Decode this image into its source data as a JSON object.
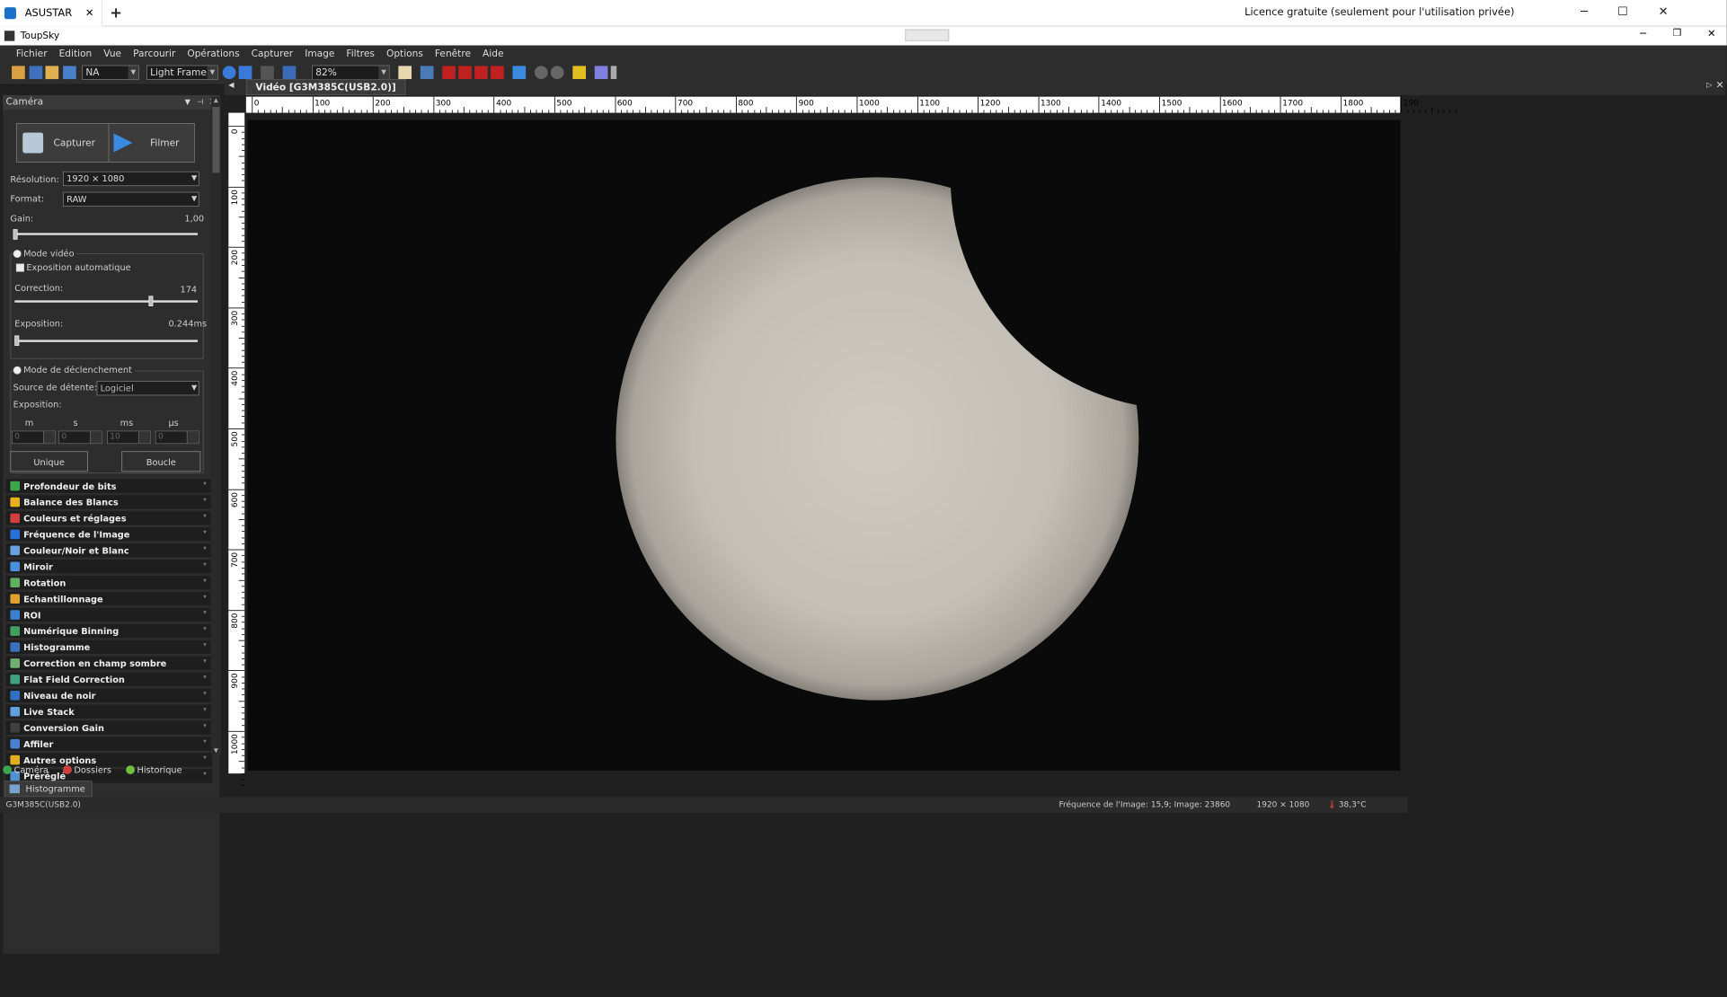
{
  "browser": {
    "tab_label": "ASUSTAR",
    "licence": "Licence gratuite (seulement pour l'utilisation privée)"
  },
  "app": {
    "title": "ToupSky"
  },
  "menu": [
    "Fichier",
    "Edition",
    "Vue",
    "Parcourir",
    "Opérations",
    "Capturer",
    "Image",
    "Filtres",
    "Options",
    "Fenêtre",
    "Aide"
  ],
  "toolbar": {
    "combo1": "NA",
    "combo2": "Light Frame",
    "zoom": "82%"
  },
  "camera_panel": {
    "title": "Caméra",
    "capture_label": "Capturer",
    "film_label": "Filmer",
    "resolution_label": "Résolution:",
    "resolution_value": "1920 × 1080",
    "format_label": "Format:",
    "format_value": "RAW",
    "gain_label": "Gain:",
    "gain_value": "1,00",
    "gain_level": 0.0,
    "video_mode_label": "Mode vidéo",
    "auto_exposure_label": "Exposition automatique",
    "correction_label": "Correction:",
    "correction_value": "174",
    "correction_level": 0.75,
    "exposure_label": "Exposition:",
    "exposure_value": "0.244ms",
    "exposure_level": 0.0,
    "trigger_mode_label": "Mode de déclenchement",
    "trigger_source_label": "Source de détente:",
    "trigger_source_value": "Logiciel",
    "trigger_exposure_label": "Exposition:",
    "units": [
      "m",
      "s",
      "ms",
      "µs"
    ],
    "unit_values": [
      "0",
      "0",
      "10",
      "0"
    ],
    "single_label": "Unique",
    "loop_label": "Boucle"
  },
  "accordion": [
    {
      "label": "Profondeur de bits",
      "color": "#3aa84a"
    },
    {
      "label": "Balance des Blancs",
      "color": "#e8b020"
    },
    {
      "label": "Couleurs et réglages",
      "color": "#d04040"
    },
    {
      "label": "Fréquence de l'Image",
      "color": "#2a70d8"
    },
    {
      "label": "Couleur/Noir et Blanc",
      "color": "#6aa0e0"
    },
    {
      "label": "Miroir",
      "color": "#4a90e0"
    },
    {
      "label": "Rotation",
      "color": "#60b060"
    },
    {
      "label": "Echantillonnage",
      "color": "#e0a030"
    },
    {
      "label": "ROI",
      "color": "#3a80d0"
    },
    {
      "label": "Numérique Binning",
      "color": "#40a060"
    },
    {
      "label": "Histogramme",
      "color": "#3a70c0"
    },
    {
      "label": "Correction en champ sombre",
      "color": "#70b070"
    },
    {
      "label": "Flat Field Correction",
      "color": "#40a080"
    },
    {
      "label": "Niveau de noir",
      "color": "#3070c0"
    },
    {
      "label": "Live Stack",
      "color": "#60a0e0"
    },
    {
      "label": "Conversion Gain",
      "color": "#404040"
    },
    {
      "label": "Affiler",
      "color": "#4a80d0"
    },
    {
      "label": "Autres options",
      "color": "#e0b020"
    },
    {
      "label": "Préréglé",
      "color": "#5090d0"
    }
  ],
  "bottom_tabs": [
    {
      "label": "Caméra",
      "color": "#3aa84a"
    },
    {
      "label": "Dossiers",
      "color": "#d04040"
    },
    {
      "label": "Historique",
      "color": "#70c040"
    }
  ],
  "histogram_tab": "Histogramme",
  "video": {
    "tab": "Vidéo [G3M385C(USB2.0)]"
  },
  "ruler": {
    "h_labels": [
      "0",
      "100",
      "200",
      "300",
      "400",
      "500",
      "600",
      "700",
      "800",
      "900",
      "1000",
      "1100",
      "1200",
      "1300",
      "1400",
      "1500",
      "1600",
      "1700",
      "1800",
      "190"
    ],
    "v_labels": [
      "0",
      "100",
      "200",
      "300",
      "400",
      "500",
      "600",
      "700",
      "800",
      "900",
      "1000"
    ]
  },
  "status": {
    "device": "G3M385C(USB2.0)",
    "frame": "Fréquence de l'Image: 15,9; Image: 23860",
    "resolution": "1920 × 1080",
    "temperature": "38,3°C"
  }
}
